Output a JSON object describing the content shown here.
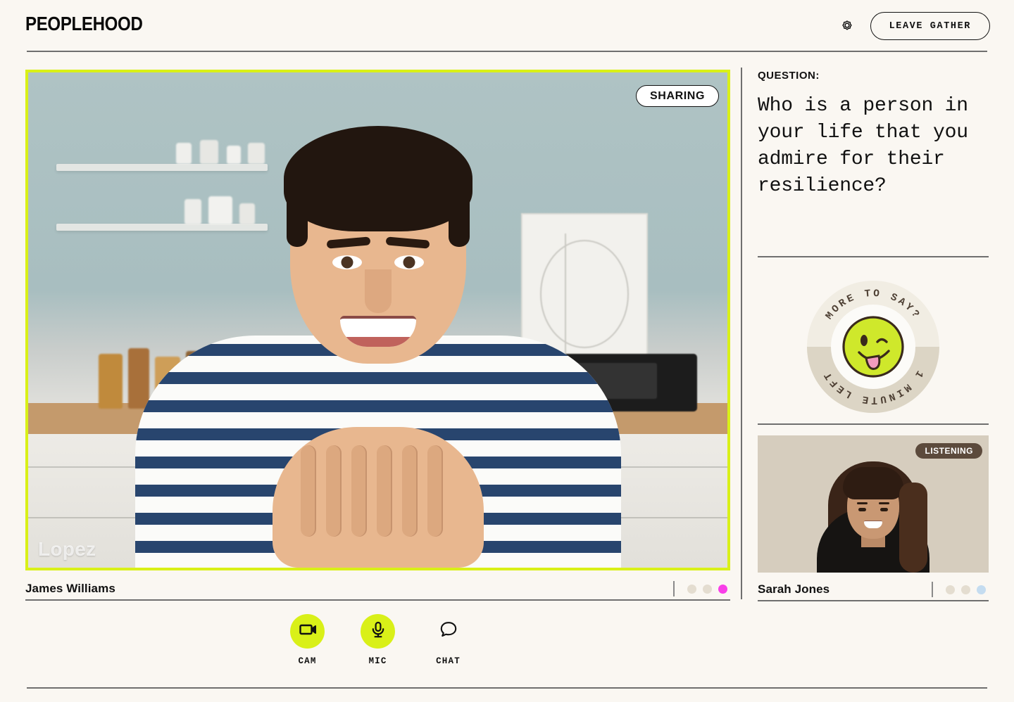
{
  "header": {
    "brand": "PEOPLEHOOD",
    "settings_icon": "gear-icon",
    "leave_label": "LEAVE GATHER"
  },
  "main_stage": {
    "status_badge": "SHARING",
    "watermark": "Lopez",
    "participant_name": "James Williams",
    "frame_color": "#D9F018",
    "connection_dots": [
      "#E4DDD0",
      "#E4DDD0",
      "#F93FE8"
    ]
  },
  "sidebar": {
    "question_label": "QUESTION:",
    "question_text": "Who is a person in your life that you admire for their resilience?",
    "timer_badge": {
      "top_text": "MORE TO SAY?",
      "bottom_text": "1 MINUTE LEFT",
      "smiley_icon": "winking-tongue-smiley-icon",
      "smiley_color": "#CFE82B",
      "ring_top_color": "#F1EDE3",
      "ring_bottom_color": "#DCD5C5"
    },
    "thumbnail": {
      "status_badge": "LISTENING",
      "participant_name": "Sarah Jones",
      "connection_dots": [
        "#E4DDD0",
        "#E4DDD0",
        "#C4DCF0"
      ],
      "badge_color": "#5C4A3C"
    }
  },
  "controls": [
    {
      "id": "cam",
      "icon": "video-camera-icon",
      "label": "CAM",
      "active": true,
      "bg": "#D9F018"
    },
    {
      "id": "mic",
      "icon": "microphone-icon",
      "label": "MIC",
      "active": true,
      "bg": "#D9F018"
    },
    {
      "id": "chat",
      "icon": "speech-bubble-icon",
      "label": "CHAT",
      "active": false,
      "bg": "transparent"
    }
  ]
}
